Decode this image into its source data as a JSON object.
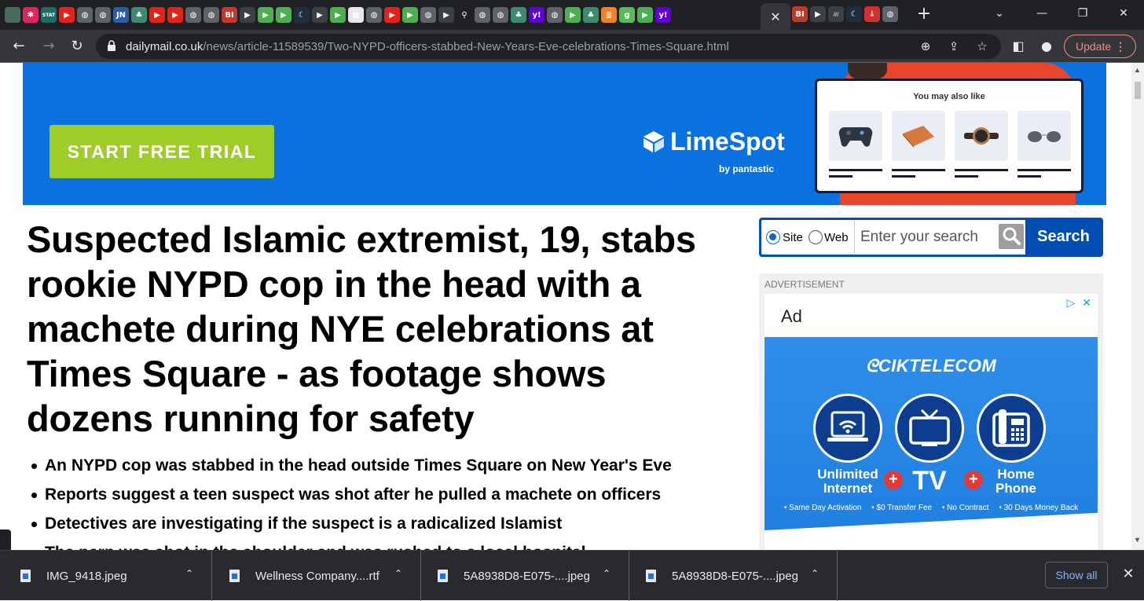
{
  "browser": {
    "tab_favicons": [
      {
        "icon": "site-globe-icon",
        "label": "",
        "color": "#4a6a5a"
      },
      {
        "icon": "pinwheel-icon",
        "label": "✱",
        "color": "#e0245e"
      },
      {
        "icon": "stat-icon",
        "label": "STAT",
        "color": "#1b6d66"
      },
      {
        "icon": "youtube-icon",
        "label": "▶",
        "color": "#e62117"
      },
      {
        "icon": "globe-icon",
        "label": "◍",
        "color": "#5f6368"
      },
      {
        "icon": "globe-icon",
        "label": "◍",
        "color": "#5f6368"
      },
      {
        "icon": "jn-icon",
        "label": "JN",
        "color": "#2a5caa"
      },
      {
        "icon": "tree-icon",
        "label": "♣",
        "color": "#3d8b6e"
      },
      {
        "icon": "youtube-icon",
        "label": "▶",
        "color": "#e62117"
      },
      {
        "icon": "youtube-icon",
        "label": "▶",
        "color": "#e62117"
      },
      {
        "icon": "globe-icon",
        "label": "◍",
        "color": "#5f6368"
      },
      {
        "icon": "globe-icon",
        "label": "◍",
        "color": "#5f6368"
      },
      {
        "icon": "bi-icon",
        "label": "BI",
        "color": "#c0392b"
      },
      {
        "icon": "flag-icon",
        "label": "▶",
        "color": "#3c4043"
      },
      {
        "icon": "rumble-icon",
        "label": "▶",
        "color": "#4caf50"
      },
      {
        "icon": "rumble-icon",
        "label": "▶",
        "color": "#4caf50"
      },
      {
        "icon": "moon-icon",
        "label": "☾",
        "color": "#1f2d3d"
      },
      {
        "icon": "flag-icon",
        "label": "▶",
        "color": "#3c4043"
      },
      {
        "icon": "rumble-icon",
        "label": "▶",
        "color": "#4caf50"
      },
      {
        "icon": "grid-icon",
        "label": "▦",
        "color": "#e8e8e8"
      },
      {
        "icon": "globe-icon",
        "label": "◍",
        "color": "#5f6368"
      },
      {
        "icon": "youtube-icon",
        "label": "▶",
        "color": "#e62117"
      },
      {
        "icon": "rumble-icon",
        "label": "▶",
        "color": "#4caf50"
      },
      {
        "icon": "globe-icon",
        "label": "◍",
        "color": "#5f6368"
      },
      {
        "icon": "flag-icon",
        "label": "▶",
        "color": "#3c4043"
      },
      {
        "icon": "search-icon",
        "label": "⚲",
        "color": "#202124"
      },
      {
        "icon": "globe-icon",
        "label": "◍",
        "color": "#5f6368"
      },
      {
        "icon": "globe-icon",
        "label": "◍",
        "color": "#5f6368"
      },
      {
        "icon": "tree-icon",
        "label": "♣",
        "color": "#3d8b6e"
      },
      {
        "icon": "yahoo-icon",
        "label": "y!",
        "color": "#6001d2"
      },
      {
        "icon": "globe-icon",
        "label": "◍",
        "color": "#5f6368"
      },
      {
        "icon": "rumble-icon",
        "label": "▶",
        "color": "#4caf50"
      },
      {
        "icon": "tree-icon",
        "label": "♣",
        "color": "#3d8b6e"
      },
      {
        "icon": "bookmark-icon",
        "label": "≣",
        "color": "#f5821f"
      },
      {
        "icon": "g-icon",
        "label": "g",
        "color": "#5cb85c"
      },
      {
        "icon": "rumble-icon",
        "label": "▶",
        "color": "#4caf50"
      },
      {
        "icon": "yahoo-icon",
        "label": "y!",
        "color": "#6001d2"
      }
    ],
    "active_tab_close": "✕",
    "tab_favicons_right": [
      {
        "icon": "bi-icon",
        "label": "BI",
        "color": "#c0392b"
      },
      {
        "icon": "flag-icon",
        "label": "▶",
        "color": "#3c4043"
      },
      {
        "icon": "slash-icon",
        "label": "///",
        "color": "#3c4043"
      },
      {
        "icon": "moon-icon",
        "label": "☾",
        "color": "#1f2d3d"
      },
      {
        "icon": "arrow-down-icon",
        "label": "↓",
        "color": "#d32f2f"
      },
      {
        "icon": "globe-icon",
        "label": "◍",
        "color": "#5f6368"
      }
    ],
    "new_tab": "+",
    "tab_search": "⌄",
    "minimize": "—",
    "maximize": "❐",
    "close": "✕",
    "url_host": "dailymail.co.uk",
    "url_path": "/news/article-11589539/Two-NYPD-officers-stabbed-New-Years-Eve-celebrations-Times-Square.html",
    "update_label": "Update",
    "update_dots": "⋮"
  },
  "banner": {
    "cta_label": "START FREE TRIAL",
    "brand": "LimeSpot",
    "brand_sub": "by pantastic",
    "widget_title": "You may also like"
  },
  "article": {
    "headline": "Suspected Islamic extremist, 19, stabs rookie NYPD cop in the head with a machete during NYE celebrations at Times Square - as footage shows dozens running for safety",
    "bullets": [
      "An NYPD cop was stabbed in the head outside Times Square on New Year's Eve",
      "Reports suggest a teen suspect was shot after he pulled a machete on officers",
      "Detectives are investigating if the suspect is a radicalized Islamist",
      "The perp was shot in the shoulder and was rushed to a local hospital"
    ]
  },
  "search": {
    "option_site": "Site",
    "option_web": "Web",
    "placeholder": "Enter your search",
    "button_label": "Search"
  },
  "ad": {
    "label": "ADVERTISEMENT",
    "ad_word": "Ad",
    "brand": "CIKTELECOM",
    "product_1": "Unlimited Internet",
    "product_2": "TV",
    "product_3": "Home Phone",
    "plus": "+",
    "features": [
      "• Same Day Activation",
      "• $0 Transfer Fee",
      "• No Contract",
      "• 30 Days Money Back"
    ]
  },
  "downloads": {
    "items": [
      {
        "name": "IMG_9418.jpeg"
      },
      {
        "name": "Wellness Company....rtf"
      },
      {
        "name": "5A8938D8-E075-....jpeg"
      },
      {
        "name": "5A8938D8-E075-....jpeg"
      }
    ],
    "chevron": "⌃",
    "show_all": "Show all",
    "close": "✕"
  },
  "colors": {
    "banner_blue": "#0a72df",
    "cta_green": "#9ecd2a",
    "search_blue": "#004db3",
    "update_red": "#f28b82"
  }
}
